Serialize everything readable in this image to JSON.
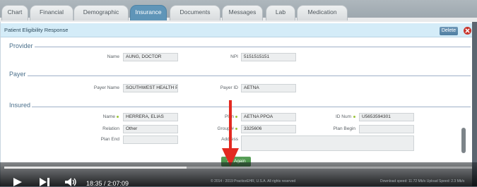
{
  "tabs": [
    {
      "label": "Chart",
      "active": false
    },
    {
      "label": "Financial",
      "active": false
    },
    {
      "label": "Demographic",
      "active": false
    },
    {
      "label": "Insurance",
      "active": true
    },
    {
      "label": "Documents",
      "active": false
    },
    {
      "label": "Messages",
      "active": false
    },
    {
      "label": "Lab",
      "active": false
    },
    {
      "label": "Medication",
      "active": false
    }
  ],
  "panel": {
    "title": "Patient Eligibility Response",
    "delete_label": "Delete",
    "close_icon": "close-icon"
  },
  "provider": {
    "section_title": "Provider",
    "name_label": "Name",
    "name_value": "AUNG, DOCTOR",
    "npi_label": "NPI",
    "npi_value": "5151515151"
  },
  "payer": {
    "section_title": "Payer",
    "payer_name_label": "Payer Name",
    "payer_name_value": "SOUTHWEST HEALTH PL/",
    "payer_id_label": "Payer ID",
    "payer_id_value": "AETNA"
  },
  "insured": {
    "section_title": "Insured",
    "name_label": "Name",
    "name_value": "HERRERA, ELIAS",
    "plan_label": "Plan",
    "plan_value": "AETNA PPOA",
    "id_num_label": "ID Num",
    "id_num_value": "U5653594301",
    "relation_label": "Relation",
    "relation_value": "Other",
    "group_label": "Group #",
    "group_value": "3325606",
    "plan_begin_label": "Plan Begin",
    "plan_begin_value": "",
    "plan_end_label": "Plan End",
    "plan_end_value": "",
    "address_label": "Address",
    "address_value": ""
  },
  "try_again_label": "Try Again",
  "player": {
    "progress": 0.39,
    "time_text": "18:35 / 2:07:09"
  },
  "footer": {
    "copyright": "© 2014 - 2019 PracticeEHR, U.S.A. All rights reserved",
    "speed": "Download speed: 11.72 Mb/s  Upload Speed: 2.3 Mb/s"
  },
  "colors": {
    "active_tab": "#5f95b8",
    "header_bg": "#d4ecf8",
    "button_green": "#4a924a",
    "arrow_red": "#e32a21",
    "close_red": "#c9342b"
  }
}
